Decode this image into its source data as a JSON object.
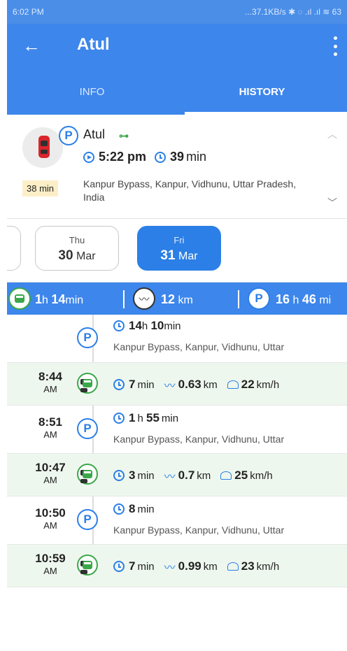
{
  "status_bar": {
    "time": "6:02 PM",
    "right": "...37.1KB/s ✱ ◌ .ıl .ıl ≋ 63"
  },
  "app_bar": {
    "back_glyph": "←",
    "title": "Atul"
  },
  "tabs": [
    {
      "label": "INFO",
      "active": false
    },
    {
      "label": "HISTORY",
      "active": true
    }
  ],
  "summary": {
    "name": "Atul",
    "start_time": "5:22 pm",
    "duration_value": "39",
    "duration_unit": "min",
    "badge": "38 min",
    "address": "Kanpur Bypass, Kanpur, Vidhunu, Uttar Pradesh, India",
    "icons": [
      "car-icon",
      "parking-icon",
      "key-icon",
      "play-icon",
      "clock-icon"
    ]
  },
  "days": [
    {
      "day": "Thu",
      "date": "30",
      "month": "Mar",
      "selected": false
    },
    {
      "day": "Fri",
      "date": "31",
      "month": "Mar",
      "selected": true
    }
  ],
  "stats": {
    "drive_h": "1",
    "drive_h_unit": "h",
    "drive_m": "14",
    "drive_m_unit": "min",
    "distance": "12",
    "distance_unit": "km",
    "park_h": "16",
    "park_h_unit": "h",
    "park_m": "46",
    "park_m_unit": "mi"
  },
  "timeline": [
    {
      "type": "park",
      "time": "",
      "ampm": "",
      "d1": "14",
      "u1": "h",
      "d2": "10",
      "u2": "min",
      "address": "Kanpur Bypass, Kanpur, Vidhunu, Uttar"
    },
    {
      "type": "drive",
      "time": "8:44",
      "ampm": "AM",
      "dur": "7",
      "dur_unit": "min",
      "dist": "0.63",
      "dist_unit": "km",
      "speed": "22",
      "speed_unit": "km/h"
    },
    {
      "type": "park",
      "time": "8:51",
      "ampm": "AM",
      "d1": "1",
      "u1": "h",
      "d2": "55",
      "u2": "min",
      "address": "Kanpur Bypass, Kanpur, Vidhunu, Uttar"
    },
    {
      "type": "drive",
      "time": "10:47",
      "ampm": "AM",
      "dur": "3",
      "dur_unit": "min",
      "dist": "0.7",
      "dist_unit": "km",
      "speed": "25",
      "speed_unit": "km/h"
    },
    {
      "type": "park",
      "time": "10:50",
      "ampm": "AM",
      "d1": "8",
      "u1": "min",
      "d2": "",
      "u2": "",
      "address": "Kanpur Bypass, Kanpur, Vidhunu, Uttar"
    },
    {
      "type": "drive",
      "time": "10:59",
      "ampm": "AM",
      "dur": "7",
      "dur_unit": "min",
      "dist": "0.99",
      "dist_unit": "km",
      "speed": "23",
      "speed_unit": "km/h"
    }
  ]
}
